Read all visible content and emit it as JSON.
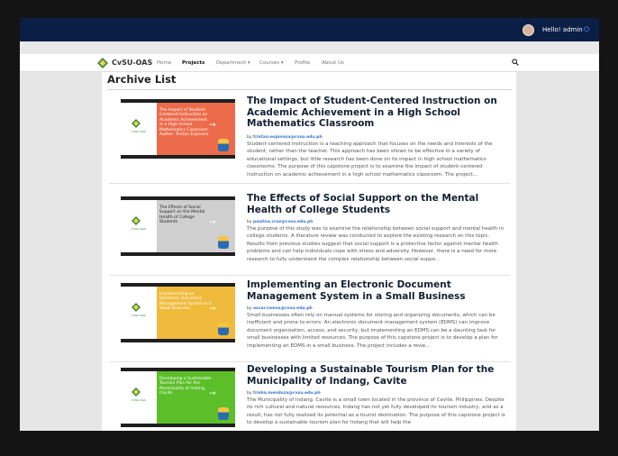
{
  "colors": {
    "topbar": "#0a1e46",
    "accent": "#3a75c4"
  },
  "topbar": {
    "greeting": "Hello! admin",
    "avatar_icon": "user-avatar",
    "power_icon": "power-icon"
  },
  "navbar": {
    "brand": "CvSU-OAS",
    "items": [
      "Home",
      "Projects",
      "Department ▾",
      "Courses ▾",
      "Profile",
      "About Us"
    ],
    "active": "Projects",
    "search_icon": "search-icon"
  },
  "page": {
    "title": "Archive List"
  },
  "archives": [
    {
      "title": "The Impact of Student-Centered Instruction on Academic Achievement in a High School Mathematics Classroom",
      "by_prefix": "by",
      "author_email": "trixtan.espinosa@cvsu.edu.ph",
      "description": "Student-centered instruction is a teaching approach that focuses on the needs and interests of the student, rather than the teacher. This approach has been shown to be effective in a variety of educational settings, but little research has been done on its impact in high school mathematics classrooms. The purpose of this capstone project is to examine the impact of student-centered instruction on academic achievement in a high school mathematics classroom. The project...",
      "thumb_text": "The Impact of Student-Centered Instruction on Academic Achievement in a High School Mathematics Classroom Author: Tristan Espinosa",
      "thumb_color": "#ec6b4a",
      "thumb_brand": "CVSU-OAS"
    },
    {
      "title": "The Effects of Social Support on the Mental Health of College Students",
      "by_prefix": "by",
      "author_email": "paulina.cruz@cvsu.edu.ph",
      "description": "The purpose of this study was to examine the relationship between social support and mental health in college students. A literature review was conducted to explore the existing research on this topic. Results from previous studies suggest that social support is a protective factor against mental health problems and can help individuals cope with stress and adversity. However, there is a need for more research to fully understand the complex relationship between social suppo...",
      "thumb_text": "The Effects of Social Support on the Mental Health of College Students",
      "thumb_color": "#cfcfcf",
      "thumb_brand": "CVSU-OAS"
    },
    {
      "title": "Implementing an Electronic Document Management System in a Small Business",
      "by_prefix": "by",
      "author_email": "oscar.ramos@cvsu.edu.ph",
      "description": "Small businesses often rely on manual systems for storing and organizing documents, which can be inefficient and prone to errors. An electronic document management system (EDMS) can improve document organization, access, and security, but implementing an EDMS can be a daunting task for small businesses with limited resources. The purpose of this capstone project is to develop a plan for implementing an EDMS in a small business. The project includes a revie...",
      "thumb_text": "Implementing an Electronic Document Management System in a Small Business",
      "thumb_color": "#f0bb3c",
      "thumb_brand": "CVSU-OAS"
    },
    {
      "title": "Developing a Sustainable Tourism Plan for the Municipality of Indang, Cavite",
      "by_prefix": "by",
      "author_email": "trisha.mendoza@cvsu.edu.ph",
      "description": "The Municipality of Indang, Cavite is a small town located in the province of Cavite, Philippines. Despite its rich cultural and natural resources, Indang has not yet fully developed its tourism industry, and as a result, has not fully realized its potential as a tourist destination. The purpose of this capstone project is to develop a sustainable tourism plan for Indang that will help the",
      "thumb_text": "Developing a Sustainable Tourism Plan for the Municipality of Indang, Cavite",
      "thumb_color": "#5cbf2a",
      "thumb_brand": "CVSU-OAS"
    }
  ]
}
